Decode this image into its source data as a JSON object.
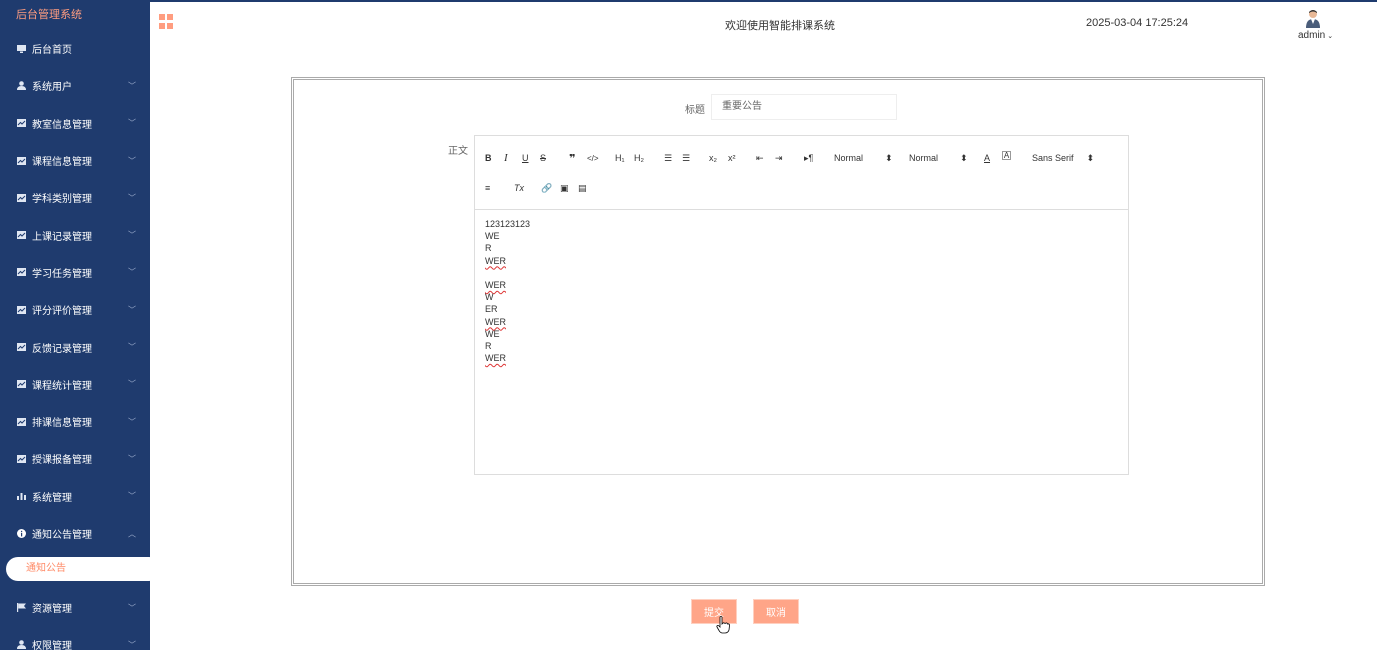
{
  "app": {
    "brand": "后台管理系统",
    "welcome": "欢迎使用智能排课系统",
    "datetime": "2025-03-04 17:25:24",
    "user": "admin"
  },
  "sidebar": {
    "items": [
      {
        "label": "后台首页",
        "icon": "monitor-icon",
        "expandable": false
      },
      {
        "label": "系统用户",
        "icon": "user-icon",
        "expandable": true
      },
      {
        "label": "教室信息管理",
        "icon": "chart-icon",
        "expandable": true
      },
      {
        "label": "课程信息管理",
        "icon": "chart-icon",
        "expandable": true
      },
      {
        "label": "学科类别管理",
        "icon": "chart-icon",
        "expandable": true
      },
      {
        "label": "上课记录管理",
        "icon": "chart-icon",
        "expandable": true
      },
      {
        "label": "学习任务管理",
        "icon": "chart-icon",
        "expandable": true
      },
      {
        "label": "评分评价管理",
        "icon": "chart-icon",
        "expandable": true
      },
      {
        "label": "反馈记录管理",
        "icon": "chart-icon",
        "expandable": true
      },
      {
        "label": "课程统计管理",
        "icon": "chart-icon",
        "expandable": true
      },
      {
        "label": "排课信息管理",
        "icon": "chart-icon",
        "expandable": true
      },
      {
        "label": "授课报备管理",
        "icon": "chart-icon",
        "expandable": true
      },
      {
        "label": "系统管理",
        "icon": "bar-chart-icon",
        "expandable": true
      },
      {
        "label": "通知公告管理",
        "icon": "info-icon",
        "expandable": true,
        "expanded": true
      }
    ],
    "active_sub": "通知公告",
    "bottom_items": [
      {
        "label": "资源管理",
        "icon": "flag-icon"
      },
      {
        "label": "权限管理",
        "icon": "user-icon"
      }
    ]
  },
  "form": {
    "title_label": "标题",
    "title_value": "重要公告",
    "body_label": "正文",
    "toolbar": {
      "header_select": "Normal",
      "size_select": "Normal",
      "font_select": "Sans Serif"
    },
    "content_lines": [
      "123123123",
      "WE",
      "R",
      "WER",
      "",
      "WER",
      "W",
      "ER",
      "WER",
      "WE",
      "R",
      "WER"
    ],
    "submit_label": "提交",
    "cancel_label": "取消"
  },
  "colors": {
    "sidebar_bg": "#1f3b6e",
    "accent": "#ffa588",
    "brand_text": "#ff9d80"
  }
}
